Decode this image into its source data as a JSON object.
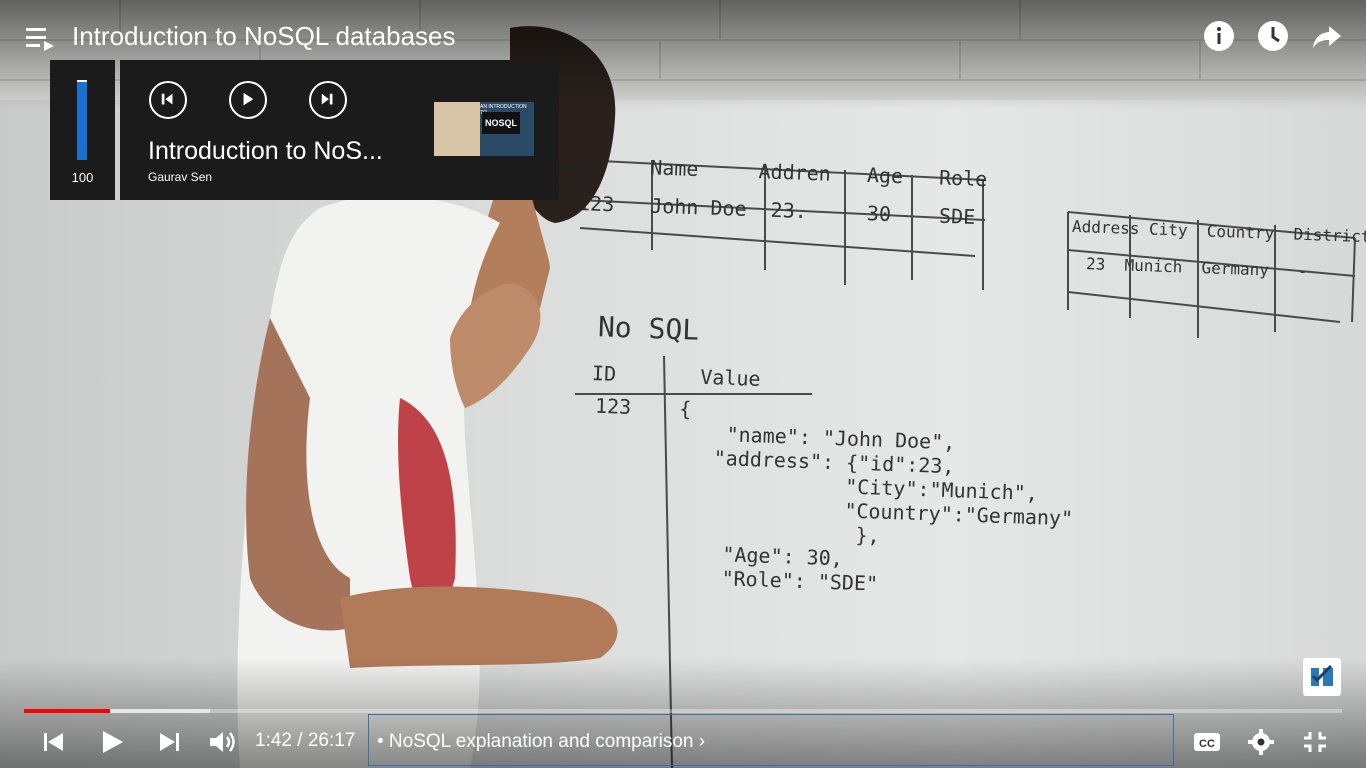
{
  "window": {
    "title": "Introduction to NoSQL databases"
  },
  "volume_popup": {
    "value": "100",
    "level_fraction": 1.0
  },
  "media_popup": {
    "title": "Introduction to NoS...",
    "artist": "Gaurav Sen",
    "thumbnail_badge": "NOSQL",
    "thumbnail_caption": "AN INTRODUCTION TO"
  },
  "player": {
    "time": "1:42 / 26:17",
    "chapter": "• NoSQL explanation and comparison",
    "chapter_chevron": "›",
    "progress_fraction": 0.065,
    "colors": {
      "played": "#ff0000",
      "volume": "#1a6fd1"
    }
  },
  "icons": {
    "playlist": "playlist-icon",
    "info": "info-icon",
    "watch_later": "clock-icon",
    "share": "share-icon",
    "prev": "skip-previous-icon",
    "play": "play-icon",
    "next": "skip-next-icon",
    "volume": "volume-icon",
    "captions": "captions-icon",
    "settings": "gear-icon",
    "exit_fullscreen": "exit-fullscreen-icon"
  }
}
